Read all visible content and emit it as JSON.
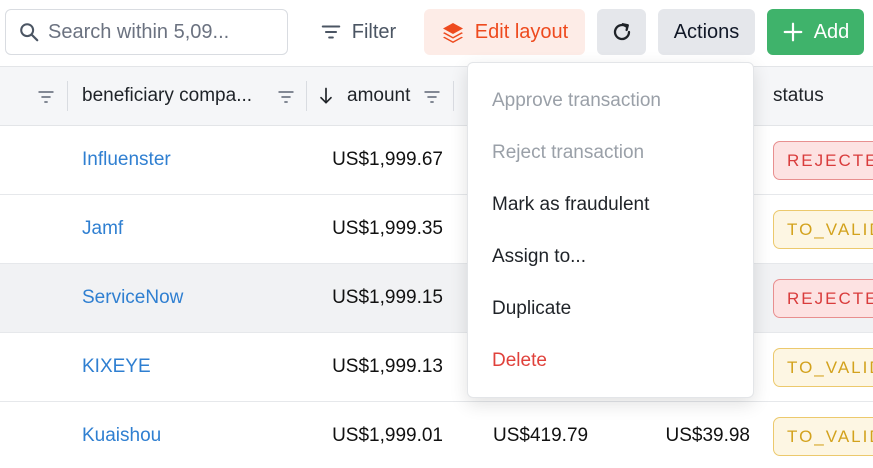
{
  "toolbar": {
    "search": {
      "placeholder": "Search within 5,09..."
    },
    "filter_label": "Filter",
    "edit_layout_label": "Edit layout",
    "actions_label": "Actions",
    "add_label": "Add"
  },
  "table": {
    "columns": {
      "beneficiary": "beneficiary compa...",
      "amount": "amount",
      "status": "status"
    },
    "rows": [
      {
        "beneficiary": "Influenster",
        "amount": "US$1,999.67",
        "amount2": "",
        "amount3": "",
        "status": "REJECTED"
      },
      {
        "beneficiary": "Jamf",
        "amount": "US$1,999.35",
        "amount2": "",
        "amount3": "",
        "status": "TO_VALIDATE"
      },
      {
        "beneficiary": "ServiceNow",
        "amount": "US$1,999.15",
        "amount2": "",
        "amount3": "",
        "status": "REJECTED"
      },
      {
        "beneficiary": "KIXEYE",
        "amount": "US$1,999.13",
        "amount2": "",
        "amount3": "",
        "status": "TO_VALIDATE"
      },
      {
        "beneficiary": "Kuaishou",
        "amount": "US$1,999.01",
        "amount2": "US$419.79",
        "amount3": "US$39.98",
        "status": "TO_VALIDATE"
      }
    ]
  },
  "menu": {
    "items": [
      {
        "label": "Approve transaction",
        "state": "disabled"
      },
      {
        "label": "Reject transaction",
        "state": "disabled"
      },
      {
        "label": "Mark as fraudulent",
        "state": "normal"
      },
      {
        "label": "Assign to...",
        "state": "normal"
      },
      {
        "label": "Duplicate",
        "state": "normal"
      },
      {
        "label": "Delete",
        "state": "danger"
      }
    ]
  },
  "colors": {
    "accent_orange": "#ee4a1e",
    "add_green": "#3fb36b",
    "link_blue": "#2f7fd1",
    "rejected_red": "#d93c3c",
    "to_validate_yellow": "#d3a21d",
    "danger_red": "#e0413b"
  },
  "icons": {
    "search": "search-icon",
    "filter": "filter-icon",
    "layers": "layers-icon",
    "refresh": "refresh-icon",
    "plus": "plus-icon",
    "column_filter": "column-filter-icon",
    "sort": "arrow-down-icon"
  }
}
